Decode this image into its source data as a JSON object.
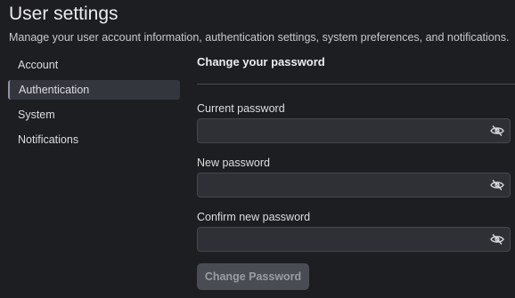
{
  "header": {
    "title": "User settings",
    "description": "Manage your user account information, authentication settings, system preferences, and notifications."
  },
  "sidebar": {
    "items": [
      {
        "label": "Account",
        "active": false
      },
      {
        "label": "Authentication",
        "active": true
      },
      {
        "label": "System",
        "active": false
      },
      {
        "label": "Notifications",
        "active": false
      }
    ]
  },
  "main": {
    "section_title": "Change your password",
    "fields": [
      {
        "label": "Current password",
        "value": "",
        "icon": "eye-off-icon"
      },
      {
        "label": "New password",
        "value": "",
        "icon": "eye-off-icon"
      },
      {
        "label": "Confirm new password",
        "value": "",
        "icon": "eye-off-icon"
      }
    ],
    "submit_label": "Change Password"
  },
  "colors": {
    "background": "#1d1e22",
    "field_background": "#2e3036",
    "active_nav_background": "#34363d",
    "disabled_button": "#4a4c53"
  }
}
